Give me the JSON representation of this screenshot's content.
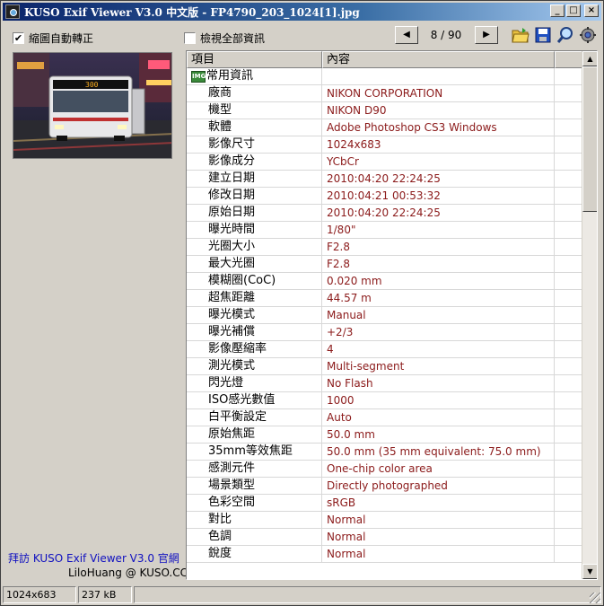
{
  "window": {
    "title": "KUSO Exif Viewer V3.0 中文版 - FP4790_203_1024[1].jpg",
    "min_glyph": "_",
    "max_glyph": "□",
    "close_glyph": "×"
  },
  "toolbar": {
    "shrink_checkbox_label": "縮圖自動轉正",
    "shrink_checked": "✔",
    "show_all_checkbox_label": "檢視全部資訊",
    "show_all_checked": "",
    "prev_glyph": "◀",
    "next_glyph": "▶",
    "page_counter": "8 / 90",
    "icons": [
      "open-folder-icon",
      "save-icon",
      "zoom-icon",
      "settings-icon"
    ]
  },
  "thumbnail": {
    "alt": "bus photo thumbnail",
    "bus_route": "300"
  },
  "footer": {
    "visit_link": "拜訪 KUSO Exif Viewer V3.0 官網",
    "credit": "LiloHuang @ KUSO.CC"
  },
  "grid": {
    "col_item": "項目",
    "col_content": "內容",
    "section_label": "常用資訊",
    "section_icon_text": "IMG",
    "rows": [
      {
        "label": "廠商",
        "value": "NIKON CORPORATION"
      },
      {
        "label": "機型",
        "value": "NIKON D90"
      },
      {
        "label": "軟體",
        "value": "Adobe Photoshop CS3 Windows"
      },
      {
        "label": "影像尺寸",
        "value": "1024x683"
      },
      {
        "label": "影像成分",
        "value": "YCbCr"
      },
      {
        "label": "建立日期",
        "value": "2010:04:20 22:24:25"
      },
      {
        "label": "修改日期",
        "value": "2010:04:21 00:53:32"
      },
      {
        "label": "原始日期",
        "value": "2010:04:20 22:24:25"
      },
      {
        "label": "曝光時間",
        "value": "1/80\""
      },
      {
        "label": "光圈大小",
        "value": "F2.8"
      },
      {
        "label": "最大光圈",
        "value": "F2.8"
      },
      {
        "label": "模糊圈(CoC)",
        "value": "0.020 mm"
      },
      {
        "label": "超焦距離",
        "value": "44.57 m"
      },
      {
        "label": "曝光模式",
        "value": "Manual"
      },
      {
        "label": "曝光補償",
        "value": "+2/3"
      },
      {
        "label": "影像壓縮率",
        "value": "4"
      },
      {
        "label": "測光模式",
        "value": "Multi-segment"
      },
      {
        "label": "閃光燈",
        "value": "No Flash"
      },
      {
        "label": "ISO感光數值",
        "value": "1000"
      },
      {
        "label": "白平衡設定",
        "value": "Auto"
      },
      {
        "label": "原始焦距",
        "value": "50.0 mm"
      },
      {
        "label": "35mm等效焦距",
        "value": "50.0 mm (35 mm equivalent: 75.0 mm)"
      },
      {
        "label": "感測元件",
        "value": "One-chip color area"
      },
      {
        "label": "場景類型",
        "value": "Directly photographed"
      },
      {
        "label": "色彩空間",
        "value": "sRGB"
      },
      {
        "label": "對比",
        "value": "Normal"
      },
      {
        "label": "色調",
        "value": "Normal"
      },
      {
        "label": "銳度",
        "value": "Normal"
      }
    ]
  },
  "status": {
    "dimensions": "1024x683",
    "filesize": "237 kB"
  }
}
